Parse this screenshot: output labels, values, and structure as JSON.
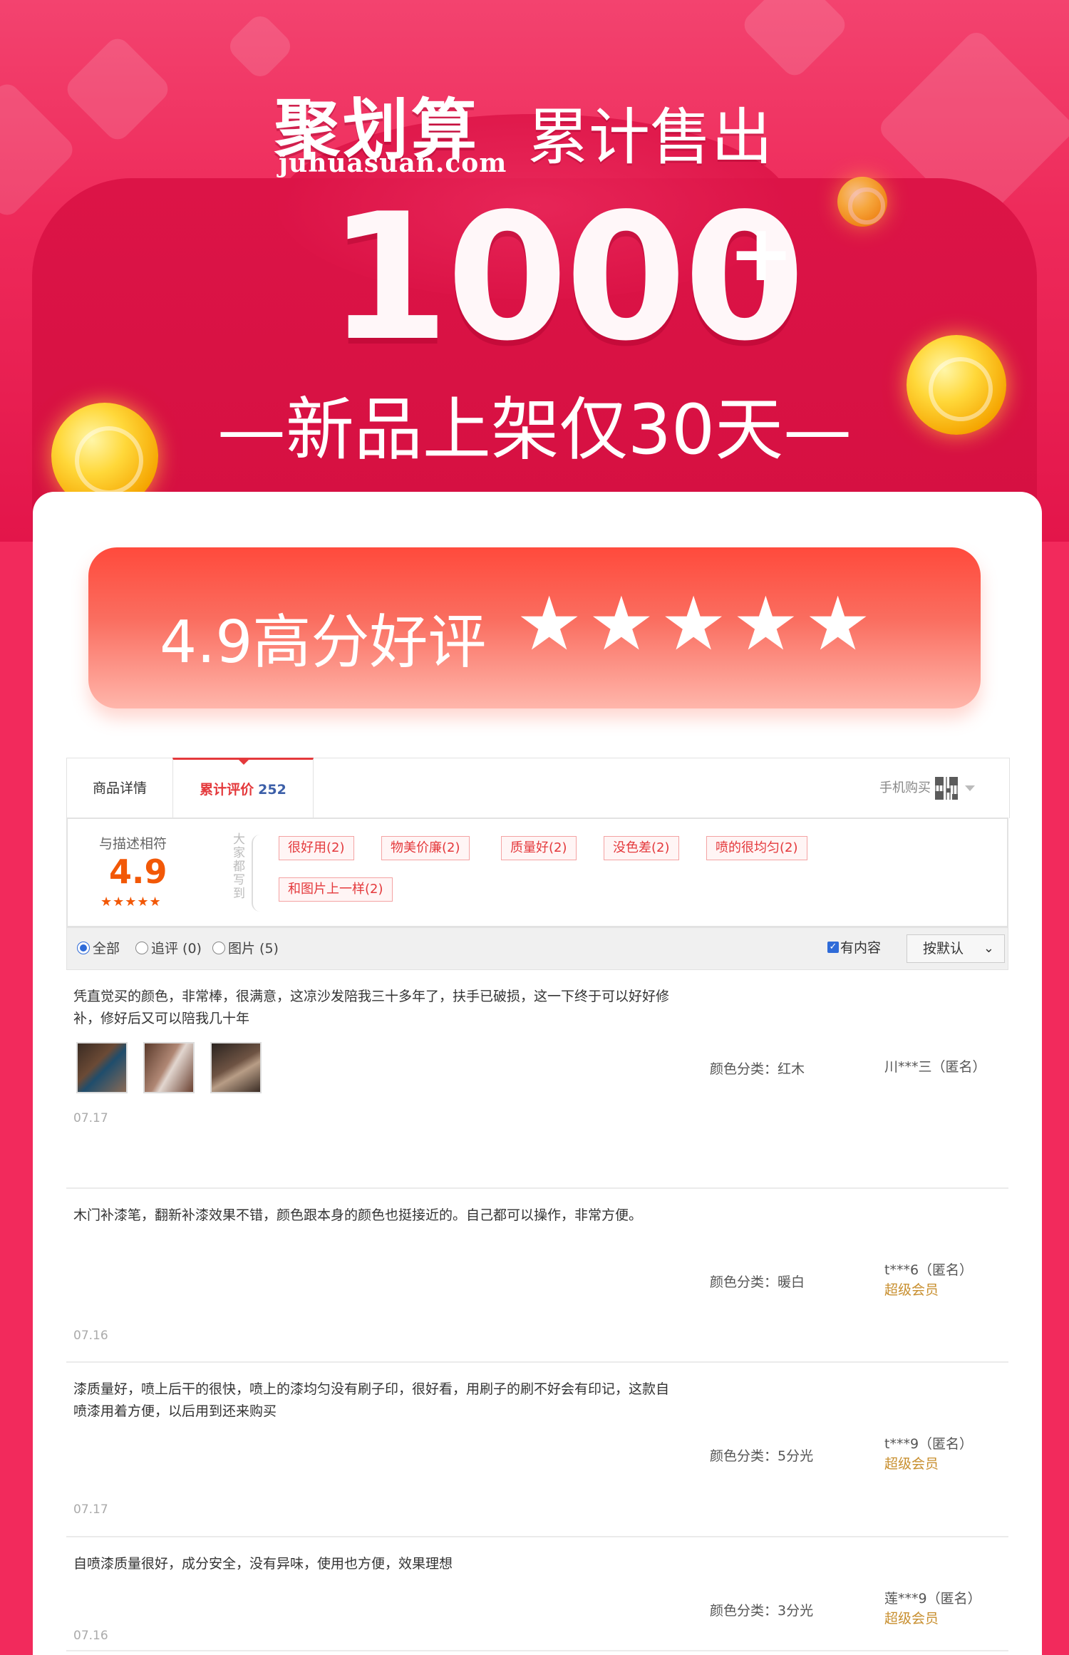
{
  "hero": {
    "brand_name": "聚划算",
    "brand_domain": "juhuasuan.com",
    "sold_label": "累计售出",
    "sold_number": "1000",
    "sold_plus": "+",
    "subtitle": "—新品上架仅30天—"
  },
  "score_banner": {
    "text": "4.9高分好评",
    "stars": "★★★★★"
  },
  "tabs": {
    "detail_label": "商品详情",
    "reviews_label": "累计评价",
    "reviews_count": "252",
    "mobile_buy_label": "手机购买"
  },
  "summary": {
    "rating_label": "与描述相符",
    "rating_value": "4.9",
    "rating_stars": "★★★★★",
    "impression_label": "大家都写到",
    "tags": [
      "很好用(2)",
      "物美价廉(2)",
      "质量好(2)",
      "没色差(2)",
      "喷的很均匀(2)",
      "和图片上一样(2)"
    ]
  },
  "filter": {
    "all_label": "全部",
    "followup_label": "追评 (0)",
    "images_label": "图片 (5)",
    "has_content_label": "有内容",
    "sort_label": "按默认",
    "selected": "all"
  },
  "reviews": [
    {
      "text": "凭直觉买的颜色，非常棒，很满意，这凉沙发陪我三十多年了，扶手已破损，这一下终于可以好好修补，修好后又可以陪我几十年",
      "date": "07.17",
      "spec": "颜色分类：红木",
      "user": "川***三（匿名）",
      "vip": ""
    },
    {
      "text": "木门补漆笔，翻新补漆效果不错，颜色跟本身的颜色也挺接近的。自己都可以操作，非常方便。",
      "date": "07.16",
      "spec": "颜色分类：暖白",
      "user": "t***6（匿名）",
      "vip": "超级会员"
    },
    {
      "text": "漆质量好，喷上后干的很快，喷上的漆均匀没有刷子印，很好看，用刷子的刷不好会有印记，这款自喷漆用着方便，以后用到还来购买",
      "date": "07.17",
      "spec": "颜色分类：5分光",
      "user": "t***9（匿名）",
      "vip": "超级会员"
    },
    {
      "text": "自喷漆质量很好，成分安全，没有异味，使用也方便，效果理想",
      "date": "07.16",
      "spec": "颜色分类：3分光",
      "user": "莲***9（匿名）",
      "vip": "超级会员"
    }
  ],
  "colors": {
    "hero_pink": "#f22a5c",
    "accent_red": "#e4393c",
    "rating_orange": "#f25807",
    "vip_gold": "#c88f2f"
  }
}
